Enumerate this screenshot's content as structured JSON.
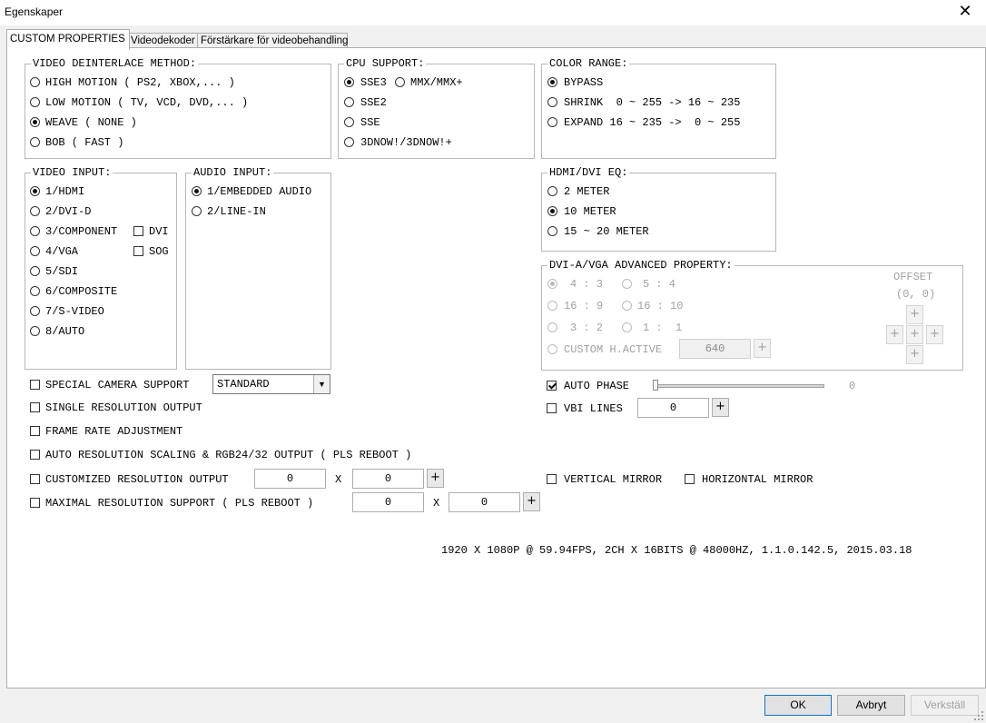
{
  "window": {
    "title": "Egenskaper",
    "close_glyph": "✕"
  },
  "tabs": [
    {
      "label": "CUSTOM PROPERTIES",
      "active": true
    },
    {
      "label": "Videodekoder",
      "active": false
    },
    {
      "label": "Förstärkare för videobehandling",
      "active": false
    }
  ],
  "deinterlace": {
    "title": "VIDEO DEINTERLACE METHOD:",
    "options": [
      "HIGH MOTION ( PS2, XBOX,... )",
      "LOW MOTION ( TV, VCD, DVD,... )",
      "WEAVE ( NONE )",
      "BOB ( FAST )"
    ],
    "selected": 2
  },
  "cpu": {
    "title": "CPU SUPPORT:",
    "options": [
      "SSE3",
      "MMX/MMX+",
      "SSE2",
      "SSE",
      "3DNOW!/3DNOW!+"
    ],
    "selected": 0
  },
  "color_range": {
    "title": "COLOR RANGE:",
    "options": [
      "BYPASS",
      "SHRINK  0 ~ 255 -> 16 ~ 235",
      "EXPAND 16 ~ 235 ->  0 ~ 255"
    ],
    "selected": 0
  },
  "video_input": {
    "title": "VIDEO INPUT:",
    "options": [
      "1/HDMI",
      "2/DVI-D",
      "3/COMPONENT",
      "4/VGA",
      "5/SDI",
      "6/COMPOSITE",
      "7/S-VIDEO",
      "8/AUTO"
    ],
    "selected": 0,
    "dvi_label": "DVI",
    "sog_label": "SOG"
  },
  "audio_input": {
    "title": "AUDIO INPUT:",
    "options": [
      "1/EMBEDDED AUDIO",
      "2/LINE-IN"
    ],
    "selected": 0
  },
  "hdmi_eq": {
    "title": "HDMI/DVI EQ:",
    "options": [
      "2 METER",
      "10 METER",
      "15 ~ 20 METER"
    ],
    "selected": 1
  },
  "advanced": {
    "title": "DVI-A/VGA ADVANCED PROPERTY:",
    "ratios": [
      "4 : 3",
      "5 : 4",
      "16 : 9",
      "16 : 10",
      "3 : 2",
      "1 :  1"
    ],
    "custom_label": "CUSTOM H.ACTIVE",
    "custom_value": "640",
    "offset_label": "OFFSET",
    "offset_value": "(0, 0)",
    "plus": "+"
  },
  "options": {
    "special_camera": "SPECIAL CAMERA SUPPORT",
    "camera_mode": "STANDARD",
    "single_resolution": "SINGLE RESOLUTION OUTPUT",
    "frame_rate": "FRAME RATE ADJUSTMENT",
    "auto_resolution": "AUTO RESOLUTION SCALING & RGB24/32 OUTPUT ( PLS REBOOT )",
    "customized_resolution": "CUSTOMIZED RESOLUTION OUTPUT",
    "custom_w": "0",
    "custom_h": "0",
    "maximal_resolution": "MAXIMAL RESOLUTION SUPPORT ( PLS REBOOT )",
    "max_w": "0",
    "max_h": "0",
    "x": "X",
    "plus": "+"
  },
  "right_options": {
    "auto_phase": "AUTO PHASE",
    "auto_phase_value": "0",
    "vbi_lines": "VBI LINES",
    "vbi_value": "0",
    "vertical_mirror": "VERTICAL MIRROR",
    "horizontal_mirror": "HORIZONTAL MIRROR",
    "plus": "+"
  },
  "status": "1920 X 1080P @ 59.94FPS, 2CH X 16BITS @ 48000HZ, 1.1.0.142.5, 2015.03.18",
  "buttons": {
    "ok": "OK",
    "cancel": "Avbryt",
    "apply": "Verkställ"
  }
}
